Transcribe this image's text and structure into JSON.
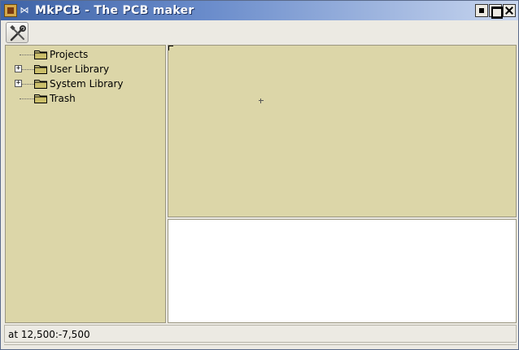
{
  "window": {
    "title": "MkPCB - The PCB maker"
  },
  "toolbar": {
    "tools_icon": "tools-icon"
  },
  "tree": {
    "items": [
      {
        "label": "Projects",
        "expandable": false
      },
      {
        "label": "User Library",
        "expandable": true,
        "expander": "+"
      },
      {
        "label": "System Library",
        "expandable": true,
        "expander": "+"
      },
      {
        "label": "Trash",
        "expandable": false
      }
    ]
  },
  "status": {
    "text": "at 12,500:-7,500"
  },
  "colors": {
    "panel_bg": "#dcd6a8",
    "title_start": "#3e63a6",
    "title_end": "#c8d6ef"
  }
}
